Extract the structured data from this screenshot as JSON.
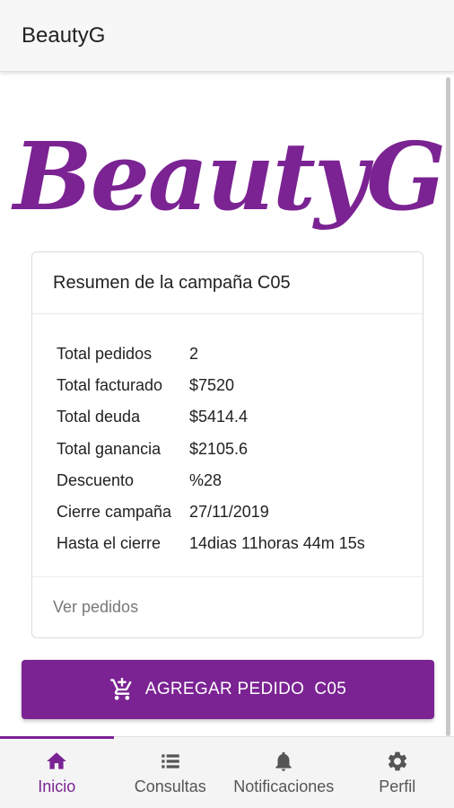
{
  "appbar": {
    "title": "BeautyG"
  },
  "logo": {
    "text": "BeautyG"
  },
  "summary": {
    "title": "Resumen de la campaña C05",
    "rows": [
      {
        "label": "Total pedidos",
        "value": "2"
      },
      {
        "label": "Total facturado",
        "value": "$7520"
      },
      {
        "label": "Total deuda",
        "value": "$5414.4"
      },
      {
        "label": "Total ganancia",
        "value": "$2105.6"
      },
      {
        "label": "Descuento",
        "value": "%28"
      },
      {
        "label": "Cierre campaña",
        "value": "27/11/2019"
      },
      {
        "label": "Hasta el cierre",
        "value": "14dias 11horas 44m 15s"
      }
    ],
    "footer_link": "Ver pedidos"
  },
  "add_button": {
    "label": "AGREGAR PEDIDO  C05",
    "icon": "add-shopping-cart-icon"
  },
  "bottom_nav": {
    "items": [
      {
        "label": "Inicio",
        "icon": "home-icon",
        "active": true
      },
      {
        "label": "Consultas",
        "icon": "list-icon",
        "active": false
      },
      {
        "label": "Notificaciones",
        "icon": "bell-icon",
        "active": false
      },
      {
        "label": "Perfil",
        "icon": "gear-icon",
        "active": false
      }
    ]
  },
  "colors": {
    "accent": "#7b2393",
    "appbar_bg": "#f7f7f7",
    "nav_bg": "#f4f4f4"
  }
}
